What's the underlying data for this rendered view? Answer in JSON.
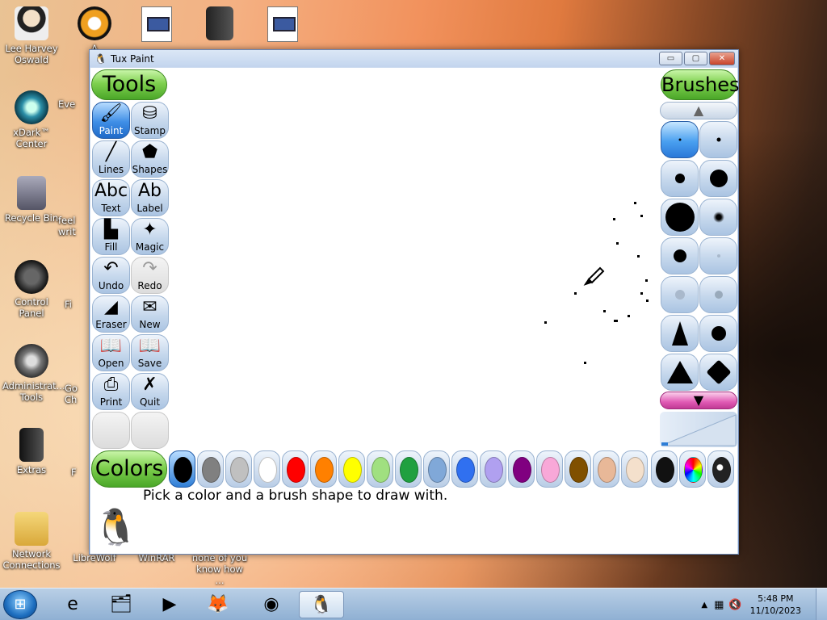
{
  "desktop": {
    "icons": [
      {
        "label": "Lee Harvey Oswald",
        "icon": "person-icon"
      },
      {
        "label": "xDark™ Center",
        "icon": "disc-icon"
      },
      {
        "label": "Recycle Bin",
        "icon": "recycle-bin-icon"
      },
      {
        "label": "Control Panel",
        "icon": "control-panel-icon"
      },
      {
        "label": "Administrat... Tools",
        "icon": "gears-icon"
      },
      {
        "label": "Extras",
        "icon": "folder-icon"
      },
      {
        "label": "Network Connections",
        "icon": "network-icon"
      },
      {
        "label": "LibreWolf",
        "icon": "browser-icon"
      },
      {
        "label": "WinRAR",
        "icon": "archive-icon"
      },
      {
        "label": "none of you know how ...",
        "icon": "document-icon"
      },
      {
        "label": "A",
        "icon": "app-icon"
      },
      {
        "label": "Eve",
        "icon": "app-icon"
      },
      {
        "label": "feel writ",
        "icon": "document-icon"
      },
      {
        "label": "Fi",
        "icon": "document-icon"
      },
      {
        "label": "Go Ch",
        "icon": "browser-icon"
      },
      {
        "label": "F",
        "icon": "document-icon"
      }
    ]
  },
  "window": {
    "title": "Tux Paint",
    "controls": {
      "minimize": "▭",
      "maximize": "▢",
      "close": "✕"
    }
  },
  "toolbar": {
    "title": "Tools",
    "tools": [
      {
        "label": "Paint",
        "glyph": "🖌",
        "state": "active"
      },
      {
        "label": "Stamp",
        "glyph": "⛁",
        "state": "normal"
      },
      {
        "label": "Lines",
        "glyph": "╱",
        "state": "normal"
      },
      {
        "label": "Shapes",
        "glyph": "⬟",
        "state": "normal"
      },
      {
        "label": "Text",
        "glyph": "Abc",
        "state": "normal"
      },
      {
        "label": "Label",
        "glyph": "Ab",
        "state": "normal"
      },
      {
        "label": "Fill",
        "glyph": "▙",
        "state": "normal"
      },
      {
        "label": "Magic",
        "glyph": "✦",
        "state": "normal"
      },
      {
        "label": "Undo",
        "glyph": "↶",
        "state": "normal"
      },
      {
        "label": "Redo",
        "glyph": "↷",
        "state": "disabled"
      },
      {
        "label": "Eraser",
        "glyph": "◢",
        "state": "normal"
      },
      {
        "label": "New",
        "glyph": "✉",
        "state": "normal"
      },
      {
        "label": "Open",
        "glyph": "📖",
        "state": "normal"
      },
      {
        "label": "Save",
        "glyph": "📖",
        "state": "normal"
      },
      {
        "label": "Print",
        "glyph": "⎙",
        "state": "normal"
      },
      {
        "label": "Quit",
        "glyph": "✗",
        "state": "normal"
      }
    ]
  },
  "brushes": {
    "title": "Brushes",
    "scroll_up": "▲",
    "scroll_down": "▼"
  },
  "colors": {
    "title": "Colors",
    "palette": [
      "#000000",
      "#808080",
      "#c0c0c0",
      "#ffffff",
      "#ff0000",
      "#ff8000",
      "#ffff00",
      "#a0e080",
      "#20a040",
      "#80a8d8",
      "#3070f0",
      "#b0a0f0",
      "#800080",
      "#f8a8d8",
      "#805000",
      "#e8b898",
      "#f4e0cc"
    ],
    "selected_index": 0
  },
  "status": {
    "message": "Pick a color and a brush shape to draw with."
  },
  "taskbar": {
    "apps": [
      {
        "name": "internet-explorer-icon",
        "glyph": "e"
      },
      {
        "name": "explorer-icon",
        "glyph": "🗂"
      },
      {
        "name": "media-player-icon",
        "glyph": "▶"
      },
      {
        "name": "firefox-icon",
        "glyph": "🦊"
      },
      {
        "name": "chrome-icon",
        "glyph": "◉"
      },
      {
        "name": "tux-paint-icon",
        "glyph": "🐧"
      }
    ],
    "time": "5:48 PM",
    "date": "11/10/2023"
  }
}
